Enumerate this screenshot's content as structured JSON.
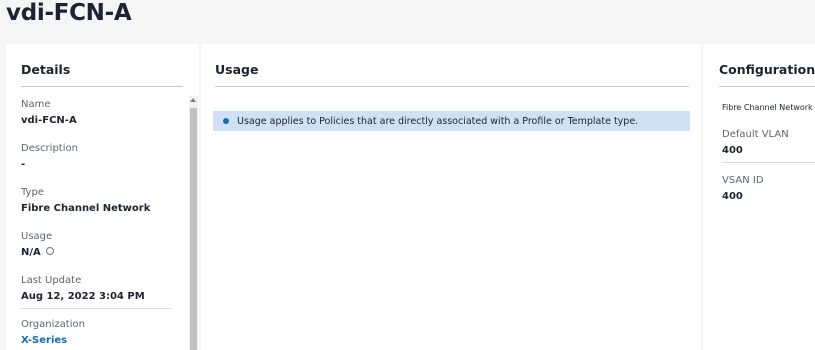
{
  "page": {
    "title": "vdi-FCN-A"
  },
  "details": {
    "header": "Details",
    "items": [
      {
        "label": "Name",
        "value": "vdi-FCN-A"
      },
      {
        "label": "Description",
        "value": "-"
      },
      {
        "label": "Type",
        "value": "Fibre Channel Network"
      },
      {
        "label": "Usage",
        "value": "N/A",
        "icon": "info-circle-icon"
      },
      {
        "label": "Last Update",
        "value": "Aug 12, 2022 3:04 PM"
      },
      {
        "label": "Organization",
        "value": "X-Series",
        "is_link": true
      }
    ]
  },
  "usage": {
    "header": "Usage",
    "banner": {
      "icon": "info-dot-icon",
      "text": "Usage applies to Policies that are directly associated with a Profile or Template type."
    }
  },
  "configuration": {
    "header": "Configuration",
    "subtitle": "Fibre Channel Network",
    "items": [
      {
        "label": "Default VLAN",
        "value": "400"
      },
      {
        "label": "VSAN ID",
        "value": "400"
      }
    ]
  },
  "colors": {
    "accent_link": "#0d6fb8",
    "banner_bg": "#cfe2f3",
    "page_bg": "#f5f5f6"
  }
}
